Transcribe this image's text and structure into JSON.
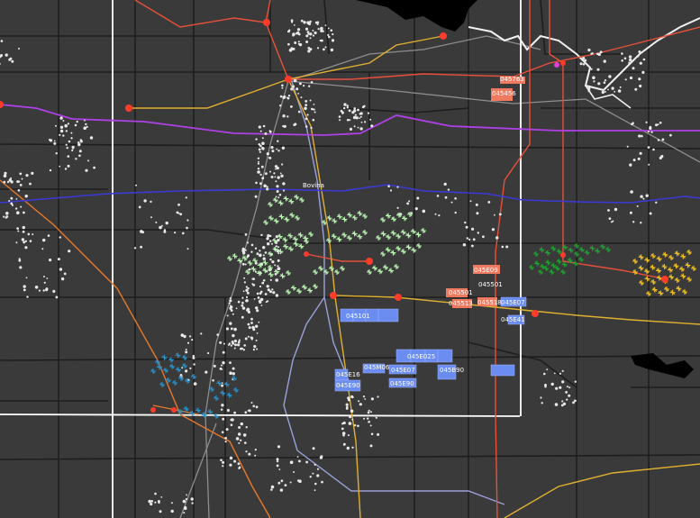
{
  "map": {
    "background": "#3a3a3a",
    "town_label": "Bovina",
    "colors": {
      "county_line": "#ffffff",
      "road_minor": "#1e1e1e",
      "road_gray": "#8e8e8e",
      "road_lavender": "#9aa0d8",
      "pipeline_red": "#e8503a",
      "pipeline_yellow": "#e0b030",
      "pipeline_orange": "#e8782a",
      "pipeline_purple": "#b040e8",
      "pipeline_blue": "#3a3ad8",
      "node_red": "#ff3b2a",
      "well_dot": "#e8e8e8",
      "wind_light_green": "#b8f0b0",
      "wind_dark_green": "#1fa030",
      "wind_yellow": "#f0c020",
      "wind_teal": "#2a90c8",
      "lease_blue": "#6b8cf0",
      "lease_salmon": "#f07a60",
      "water": "#000000"
    },
    "lease_labels": [
      "045763",
      "045456",
      "045E09",
      "045501",
      "045501",
      "045513",
      "045518",
      "045E07",
      "045E41",
      "045101",
      "045E025",
      "045M06",
      "045E07",
      "045B90",
      "045E16",
      "045E90",
      "045E90"
    ]
  }
}
